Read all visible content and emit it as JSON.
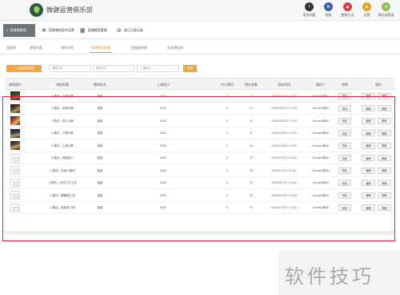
{
  "app": {
    "title": "微健运营俱乐部"
  },
  "top_icons": [
    {
      "icon": "help-icon",
      "label": "常见问题",
      "color": "#333333",
      "glyph": "?"
    },
    {
      "icon": "update-icon",
      "label": "智能",
      "color": "#3b5bb5",
      "glyph": "N"
    },
    {
      "icon": "log-icon",
      "label": "更新日志",
      "color": "#d33d3d",
      "glyph": "◆"
    },
    {
      "icon": "manage-icon",
      "label": "运营",
      "color": "#f0a020",
      "glyph": "▪"
    },
    {
      "icon": "club-icon",
      "label": "俱乐部管理",
      "color": "#8fc04a",
      "glyph": "A"
    }
  ],
  "toolbar": {
    "back_label": "←  团课课管理",
    "items": [
      {
        "icon": "gear-icon",
        "glyph": "✲",
        "label": "团课课程发布设置"
      },
      {
        "icon": "grid-icon",
        "glyph": "▦",
        "label": "团课教室管理"
      },
      {
        "icon": "no-icon",
        "glyph": "⊘",
        "label": "退订记录记录"
      }
    ]
  },
  "tabs": [
    {
      "label": "团课表",
      "active": false
    },
    {
      "label": "课程列表",
      "active": false
    },
    {
      "label": "预约列表",
      "active": false
    },
    {
      "label": "团课课程管理",
      "active": true
    },
    {
      "label": "团课课排期",
      "active": false
    },
    {
      "label": "生成课程表",
      "active": false
    }
  ],
  "filters": {
    "add_label": "+ 添加团课课程",
    "inputs": [
      {
        "placeholder": "课程名称"
      },
      {
        "placeholder": "教练姓名"
      },
      {
        "placeholder": "上课地点"
      }
    ],
    "search_label": "搜索"
  },
  "table": {
    "headers": [
      "课程图片",
      "课程标题",
      "教练姓名",
      "上课地点",
      "今日预约",
      "预约总数",
      "添加时间",
      "操作人",
      "排期",
      "操作"
    ],
    "rows": [
      {
        "thumb": "photo",
        "title": "小撸花—高难训练",
        "coach": "谢蓝",
        "location": "3202",
        "today": "0",
        "total": "14",
        "time": "2020/10/23 17:45",
        "operator": "lixinwei搞40",
        "schedule": "排出",
        "edit": "编辑",
        "delete": "删除"
      },
      {
        "thumb": "photo",
        "title": "小撸花—高难训练",
        "coach": "谢蓝",
        "location": "3202",
        "today": "0",
        "total": "11",
        "time": "2020/10/23 17:39",
        "operator": "lixinwei搞40",
        "schedule": "排出",
        "edit": "编辑",
        "delete": "删除"
      },
      {
        "thumb": "photo",
        "title": "小撸花—核心训练",
        "coach": "谢蓝",
        "location": "3202",
        "today": "0",
        "total": "6",
        "time": "2020/10/23 17:35",
        "operator": "lixinwei搞40",
        "schedule": "排出",
        "edit": "编辑",
        "delete": "删除"
      },
      {
        "thumb": "photo",
        "title": "小撸花—下肢训练",
        "coach": "谢蓝",
        "location": "3202",
        "today": "0",
        "total": "6",
        "time": "2020/10/23 17:34",
        "operator": "lixinwei搞40",
        "schedule": "排出",
        "edit": "编辑",
        "delete": "删除"
      },
      {
        "thumb": "photo",
        "title": "小撸花—上肢训练",
        "coach": "谢蓝",
        "location": "3202",
        "today": "0",
        "total": "10",
        "time": "2020/10/23 17:30",
        "operator": "lixinwei搞40",
        "schedule": "排出",
        "edit": "编辑",
        "delete": "删除"
      },
      {
        "thumb": "blank",
        "title": "小撸花—燃脂核心",
        "coach": "谢蓝",
        "location": "3202",
        "today": "0",
        "total": "15",
        "time": "2020/07/17 11:44",
        "operator": "lixinwei搞40",
        "schedule": "排出",
        "edit": "编辑",
        "delete": "删除"
      },
      {
        "thumb": "blank",
        "title": "小撸花—全身小圈球",
        "coach": "谢蓝",
        "location": "3202",
        "today": "0",
        "total": "16",
        "time": "2020/07/17 11:42",
        "operator": "lixinwei搞40",
        "schedule": "排出",
        "edit": "编辑",
        "delete": "删除"
      },
      {
        "thumb": "blank",
        "title": "小撸花—冷热门口之球",
        "coach": "谢蓝",
        "location": "3202",
        "today": "0",
        "total": "23",
        "time": "2020/07/17 11:41",
        "operator": "lixinwei搞40",
        "schedule": "排出",
        "edit": "编辑",
        "delete": "删除"
      },
      {
        "thumb": "blank",
        "title": "小撸花—腰髋臀之球",
        "coach": "谢蓝",
        "location": "3202",
        "today": "0",
        "total": "23",
        "time": "2020/07/17 11:39",
        "operator": "lixinwei搞40",
        "schedule": "排出",
        "edit": "编辑",
        "delete": "删除"
      },
      {
        "thumb": "blank",
        "title": "小撸花—极致背习球",
        "coach": "谢蓝",
        "location": "3202",
        "today": "0",
        "total": "37",
        "time": "2020/07/17 11:38",
        "operator": "lixinwei搞40",
        "schedule": "排出",
        "edit": "编辑",
        "delete": "删除"
      }
    ]
  },
  "watermark": {
    "text": "软件技巧"
  },
  "colors": {
    "accent": "#f5a540",
    "highlight": "#e0242b",
    "back_button": "#6e7478"
  }
}
